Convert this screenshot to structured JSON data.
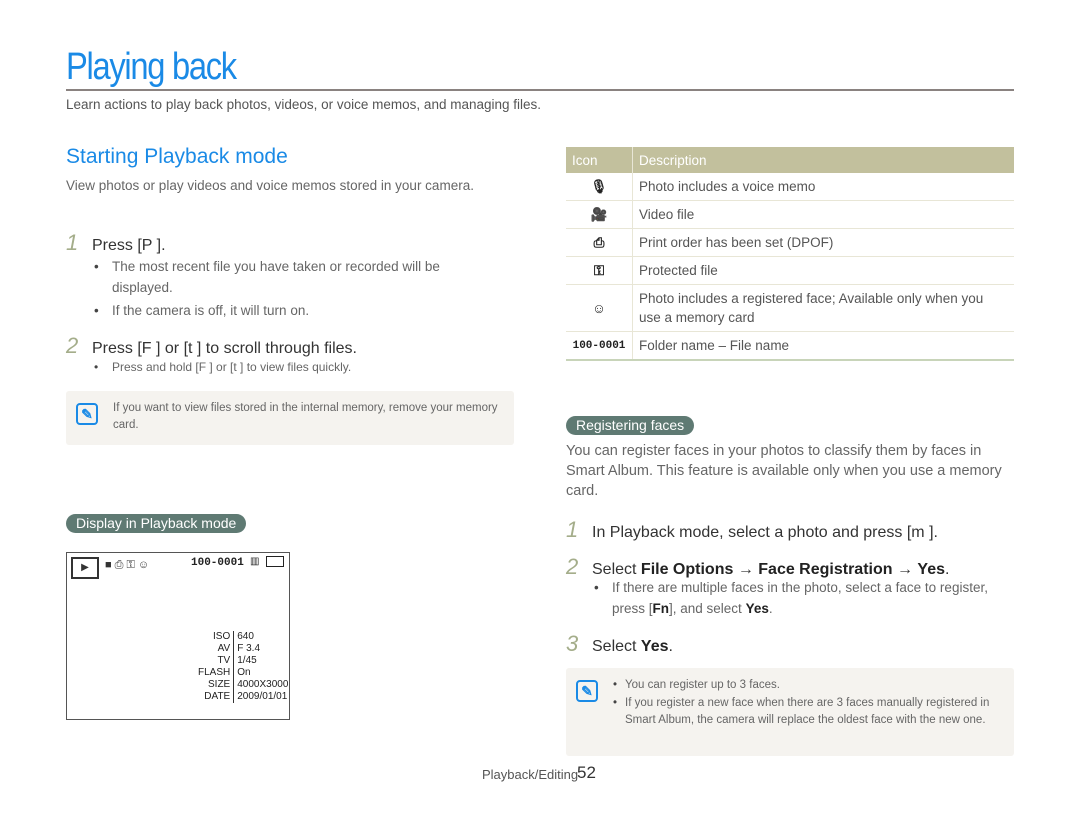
{
  "page": {
    "title": "Playing back",
    "intro": "Learn actions to play back photos, videos, or voice memos, and managing files.",
    "footer_section": "Playback/Editing",
    "footer_page": "52"
  },
  "left": {
    "heading": "Starting Playback mode",
    "description": "View photos or play videos and voice memos stored in your camera.",
    "steps": [
      {
        "num": "1",
        "text": "Press [P   ].",
        "bullets": [
          "The most recent file you have taken or recorded will be displayed.",
          "If the camera is off, it will turn on."
        ]
      },
      {
        "num": "2",
        "text": "Press [F  ] or [t    ] to scroll through files.",
        "bullets": [
          "Press and hold [F  ] or [t    ] to view files quickly."
        ]
      }
    ],
    "note": "If you want to view files stored in the internal memory, remove your memory card.",
    "display_label": "Display in Playback mode",
    "lcd": {
      "file": "100-0001",
      "info": [
        {
          "k": "ISO",
          "v": "640"
        },
        {
          "k": "AV",
          "v": "F 3.4"
        },
        {
          "k": "TV",
          "v": "1/45"
        },
        {
          "k": "FLASH",
          "v": "On"
        },
        {
          "k": "SIZE",
          "v": "4000X3000"
        },
        {
          "k": "DATE",
          "v": "2009/01/01"
        }
      ]
    }
  },
  "right": {
    "table": {
      "headers": [
        "Icon",
        "Description"
      ],
      "rows": [
        {
          "icon": "microphone-icon",
          "glyph": "🎙",
          "desc": "Photo includes a voice memo"
        },
        {
          "icon": "video-camera-icon",
          "glyph": "🎥",
          "desc": "Video file"
        },
        {
          "icon": "printer-icon",
          "glyph": "⎙",
          "desc": "Print order has been set (DPOF)"
        },
        {
          "icon": "key-icon",
          "glyph": "⚿",
          "desc": "Protected file"
        },
        {
          "icon": "face-registered-icon",
          "glyph": "☺",
          "desc": "Photo includes a registered face; Available only when you use a memory card"
        },
        {
          "icon": "folder-file-number",
          "glyph": "100-0001",
          "desc": "Folder name – File name"
        }
      ]
    },
    "registering_label": "Registering faces",
    "registering_desc": "You can register faces in your photos to classify them by faces in Smart Album. This feature is available only when you use a memory card.",
    "steps": [
      {
        "num": "1",
        "pre": "In Playback mode, select a photo and press [m       ]."
      },
      {
        "num": "2",
        "pre": "Select ",
        "b1": "File Options",
        "arrow1": " → ",
        "b2": "Face Registration",
        "arrow2": " → ",
        "b3": "Yes",
        "post": ".",
        "bullet_pre": "If there are multiple faces in the photo, select a face to register, press [",
        "bullet_b1": "Fn",
        "bullet_mid": "], and select ",
        "bullet_b2": "Yes",
        "bullet_post": "."
      },
      {
        "num": "3",
        "pre": "Select ",
        "b1": "Yes",
        "post": "."
      }
    ],
    "notes": [
      "You can register up to 3 faces.",
      "If you register a new face when there are 3 faces manually registered in Smart Album, the camera will replace the oldest face with the new one."
    ]
  }
}
